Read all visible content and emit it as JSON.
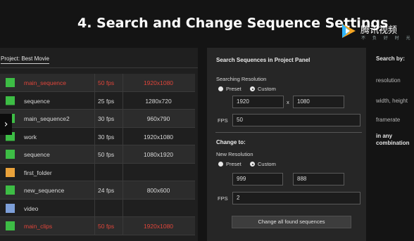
{
  "slide": {
    "title": "4. Search and Change Sequence Settings"
  },
  "logo": {
    "brand": "腾讯视频",
    "sub": "不 负 好 时 光"
  },
  "project": {
    "tab_label": "Project: Best Movie",
    "rows": [
      {
        "type": "sequence",
        "name": "main_sequence",
        "fps": "50 fps",
        "res": "1920x1080",
        "color": "#3dbd45",
        "highlight": "red"
      },
      {
        "type": "sequence",
        "name": "sequence",
        "fps": "25 fps",
        "res": "1280x720",
        "color": "#3dbd45",
        "highlight": ""
      },
      {
        "type": "sequence",
        "name": "main_sequence2",
        "fps": "30 fps",
        "res": "960x790",
        "color": "#3dbd45",
        "highlight": ""
      },
      {
        "type": "sequence",
        "name": "work",
        "fps": "30 fps",
        "res": "1920x1080",
        "color": "#3dbd45",
        "highlight": ""
      },
      {
        "type": "sequence",
        "name": "sequence",
        "fps": "50 fps",
        "res": "1080x1920",
        "color": "#3dbd45",
        "highlight": ""
      },
      {
        "type": "folder",
        "name": "first_folder",
        "fps": "",
        "res": "",
        "color": "#e9a23b",
        "highlight": ""
      },
      {
        "type": "sequence",
        "name": "new_sequence",
        "fps": "24 fps",
        "res": "800x600",
        "color": "#3dbd45",
        "highlight": ""
      },
      {
        "type": "clip",
        "name": "video",
        "fps": "",
        "res": "",
        "color": "#7d9fd8",
        "highlight": ""
      },
      {
        "type": "sequence",
        "name": "main_clips",
        "fps": "50 fps",
        "res": "1920x1080",
        "color": "#3dbd45",
        "highlight": "red"
      }
    ],
    "nav_arrow": "›"
  },
  "search_panel": {
    "title": "Search Sequences in Project Panel",
    "searching_label": "Searching Resolution",
    "preset_label": "Preset",
    "custom_label": "Custom",
    "width_value": "1920",
    "x_label": "x",
    "height_value": "1080",
    "fps_label": "FPS",
    "fps_value": "50",
    "change_to_label": "Change to:",
    "new_res_label": "New Resolution",
    "new_preset_label": "Preset",
    "new_custom_label": "Custom",
    "new_width_value": "999",
    "new_height_value": "888",
    "new_fps_label": "FPS",
    "new_fps_value": "2",
    "button_label": "Change all found sequences"
  },
  "notes": {
    "heading": "Search by:",
    "items": [
      "resolution",
      "width, height",
      "framerate"
    ],
    "bold_1": "in any",
    "bold_2": "combination"
  }
}
